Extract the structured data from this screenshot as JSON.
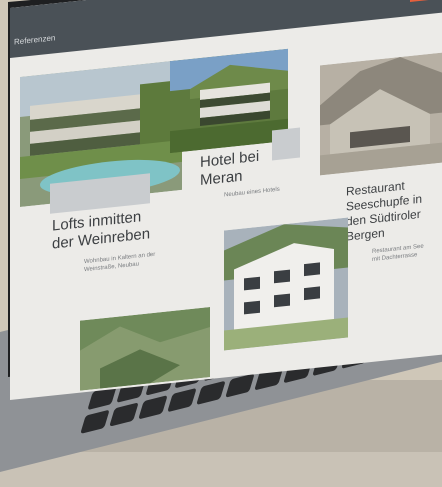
{
  "header": {
    "breadcrumb": "Referenzen",
    "top_link": "",
    "menu_icon": "hamburger-icon",
    "menu_color": "#e8603c",
    "bar_color": "#4a5157"
  },
  "cards": [
    {
      "title_line1": "Lofts inmitten",
      "title_line2": "der Weinreben",
      "sub_line1": "Wohnbau in Kaltern an der",
      "sub_line2": "Weinstraße, Neubau"
    },
    {
      "title_line1": "Hotel bei",
      "title_line2": "Meran",
      "sub_line1": "Neubau eines Hotels",
      "sub_line2": ""
    },
    {
      "title_line1": "Restaurant",
      "title_line2": "Seeschupfe in",
      "title_line3": "den Südtiroler",
      "title_line4": "Bergen",
      "sub_line1": "Restaurant am See",
      "sub_line2": "mit Dachterrasse"
    }
  ]
}
